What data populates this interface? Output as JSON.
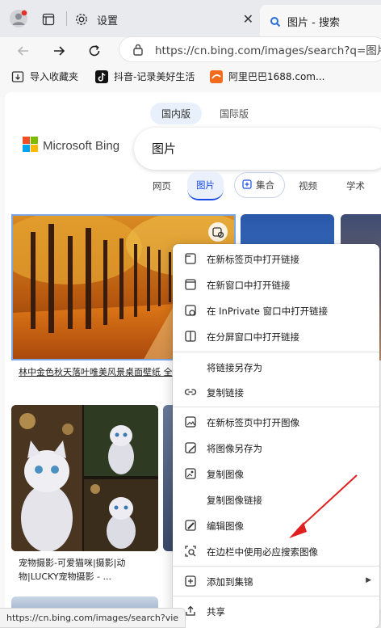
{
  "browser": {
    "tabs": [
      {
        "title": "设置"
      },
      {
        "title": "图片 - 搜索"
      }
    ],
    "url": "https://cn.bing.com/images/search?q=图片&",
    "favorites": [
      {
        "label": "导入收藏夹"
      },
      {
        "label": "抖音-记录美好生活"
      },
      {
        "label": "阿里巴巴1688.com..."
      }
    ],
    "status_url": "https://cn.bing.com/images/search?vie"
  },
  "bing": {
    "market_tabs": [
      "国内版",
      "国际版"
    ],
    "logo_text": "Microsoft Bing",
    "query": "图片",
    "scopes": [
      "网页",
      "图片",
      "集合",
      "视频",
      "学术"
    ],
    "results": [
      {
        "caption": "林中金色秋天落叶唯美风景桌面壁纸 全"
      },
      {
        "caption": "宠物摄影-可爱猫咪|摄影|动物|LUCKY宠物摄影 - ..."
      }
    ]
  },
  "context_menu": {
    "groups": [
      [
        "在新标签页中打开链接",
        "在新窗口中打开链接",
        "在 InPrivate 窗口中打开链接",
        "在分屏窗口中打开链接"
      ],
      [
        "将链接另存为",
        "复制链接"
      ],
      [
        "在新标签页中打开图像",
        "将图像另存为",
        "复制图像",
        "复制图像链接",
        "编辑图像",
        "在边栏中使用必应搜索图像"
      ],
      [
        "添加到集锦"
      ],
      [
        "共享"
      ]
    ]
  },
  "colors": {
    "accent": "#174ae4",
    "annotation_arrow": "#e02020"
  }
}
